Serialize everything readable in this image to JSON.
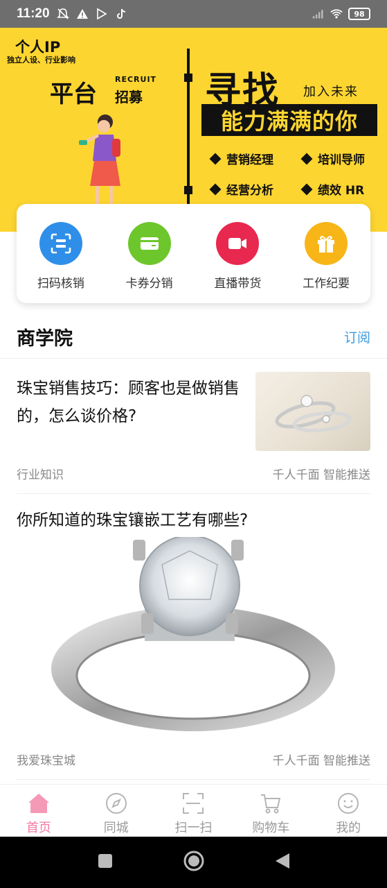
{
  "status_bar": {
    "time": "11:20",
    "battery": "98"
  },
  "banner": {
    "ip_title": "个人IP",
    "ip_sub": "独立人设、行业影响",
    "recruit_en": "RECRUIT",
    "platform": "平台",
    "zhaomu": "招募",
    "xunzhao": "寻找",
    "join": "加入未来",
    "slogan": "能力满满的你",
    "positions": [
      "营销经理",
      "培训导师",
      "经营分析",
      "绩效 HR"
    ],
    "colors": {
      "background": "#fdd530",
      "text": "#111111"
    }
  },
  "shortcuts": [
    {
      "label": "扫码核销",
      "icon": "scan-icon",
      "color": "#2f8fe8"
    },
    {
      "label": "卡券分销",
      "icon": "card-icon",
      "color": "#6dc62b"
    },
    {
      "label": "直播带货",
      "icon": "video-icon",
      "color": "#e8284f"
    },
    {
      "label": "工作纪要",
      "icon": "gift-icon",
      "color": "#f7b518"
    }
  ],
  "section": {
    "title": "商学院",
    "subscribe": "订阅"
  },
  "articles": [
    {
      "title": "珠宝销售技巧：顾客也是做销售的，怎么谈价格?",
      "category": "行业知识",
      "tag": "千人千面 智能推送"
    },
    {
      "title": "你所知道的珠宝镶嵌工艺有哪些?",
      "category": "我爱珠宝城",
      "tag": "千人千面 智能推送"
    }
  ],
  "bottom_nav": [
    {
      "label": "首页",
      "icon": "home-icon",
      "active": true
    },
    {
      "label": "同城",
      "icon": "compass-icon",
      "active": false
    },
    {
      "label": "扫一扫",
      "icon": "scan-frame-icon",
      "active": false
    },
    {
      "label": "购物车",
      "icon": "cart-icon",
      "active": false
    },
    {
      "label": "我的",
      "icon": "smile-icon",
      "active": false
    }
  ],
  "accent_color": "#f27aa0",
  "link_color": "#3a9be0"
}
